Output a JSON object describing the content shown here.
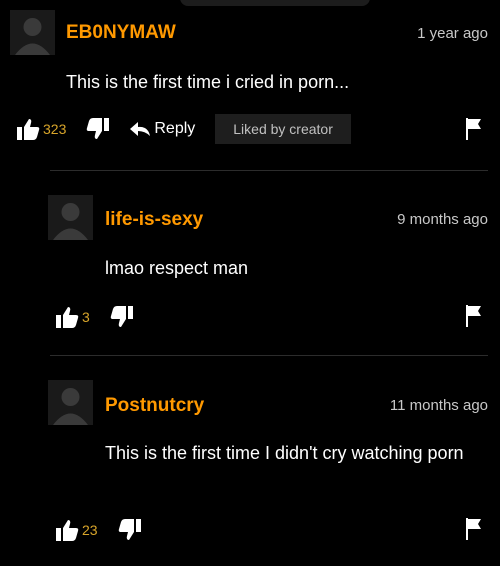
{
  "comments": [
    {
      "username": "EB0NYMAW",
      "time": "1 year ago",
      "text": "This is the first time i cried in porn...",
      "likes": "323",
      "reply_label": "Reply",
      "liked_badge": "Liked by creator"
    },
    {
      "username": "life-is-sexy",
      "time": "9 months ago",
      "text": "lmao respect man",
      "likes": "3"
    },
    {
      "username": "Postnutcry",
      "time": "11 months ago",
      "text": "This is the first time I didn't cry watching porn",
      "likes": "23"
    }
  ],
  "colors": {
    "username": "#ff9900",
    "count": "#d8a52a",
    "background": "#000000"
  },
  "icons": [
    "avatar-silhouette",
    "thumbs-up-icon",
    "thumbs-down-icon",
    "reply-arrow-icon",
    "flag-icon"
  ]
}
